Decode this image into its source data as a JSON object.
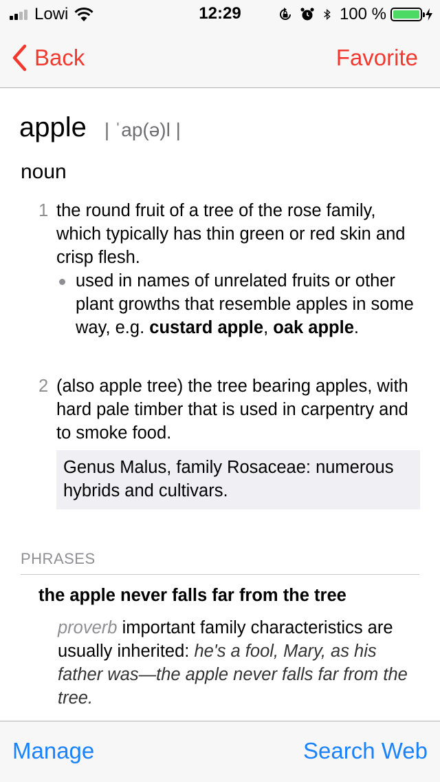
{
  "status_bar": {
    "carrier": "Lowi",
    "time": "12:29",
    "battery_percent": "100 %",
    "signal_bars": 4,
    "signal_active": 2,
    "battery_level": 1.0,
    "icons": [
      "signal-icon",
      "wifi-icon",
      "rotation-lock-icon",
      "alarm-icon",
      "bluetooth-icon",
      "battery-icon",
      "charging-bolt-icon"
    ]
  },
  "nav": {
    "back_label": "Back",
    "favorite_label": "Favorite",
    "accent_color": "#f2392f"
  },
  "entry": {
    "headword": "apple",
    "pronunciation": "| ˈap(ə)l |",
    "part_of_speech": "noun",
    "senses": [
      {
        "number": "1",
        "text": "the round fruit of a tree of the rose family, which typically has thin green or red skin and crisp flesh.",
        "sub": {
          "text_before": "used in names of unrelated fruits or other plant growths that resemble apples in some way, e.g.",
          "bold1": "custard apple",
          "sep": ",",
          "bold2": "oak apple",
          "end": "."
        }
      },
      {
        "number": "2",
        "text": "(also apple tree) the tree bearing apples, with hard pale timber that is used in carpentry and to smoke food.",
        "note": "Genus Malus, family Rosaceae: numerous hybrids and cultivars."
      }
    ],
    "phrases_header": "PHRASES",
    "phrases": [
      {
        "title": "the apple never falls far from the tree",
        "label": "proverb",
        "definition": "important family characteristics are usually inherited:",
        "example": "he's a fool, Mary, as his father was—the apple never falls far from the tree."
      }
    ]
  },
  "toolbar": {
    "manage_label": "Manage",
    "search_web_label": "Search Web",
    "accent_color": "#1a82fb"
  }
}
